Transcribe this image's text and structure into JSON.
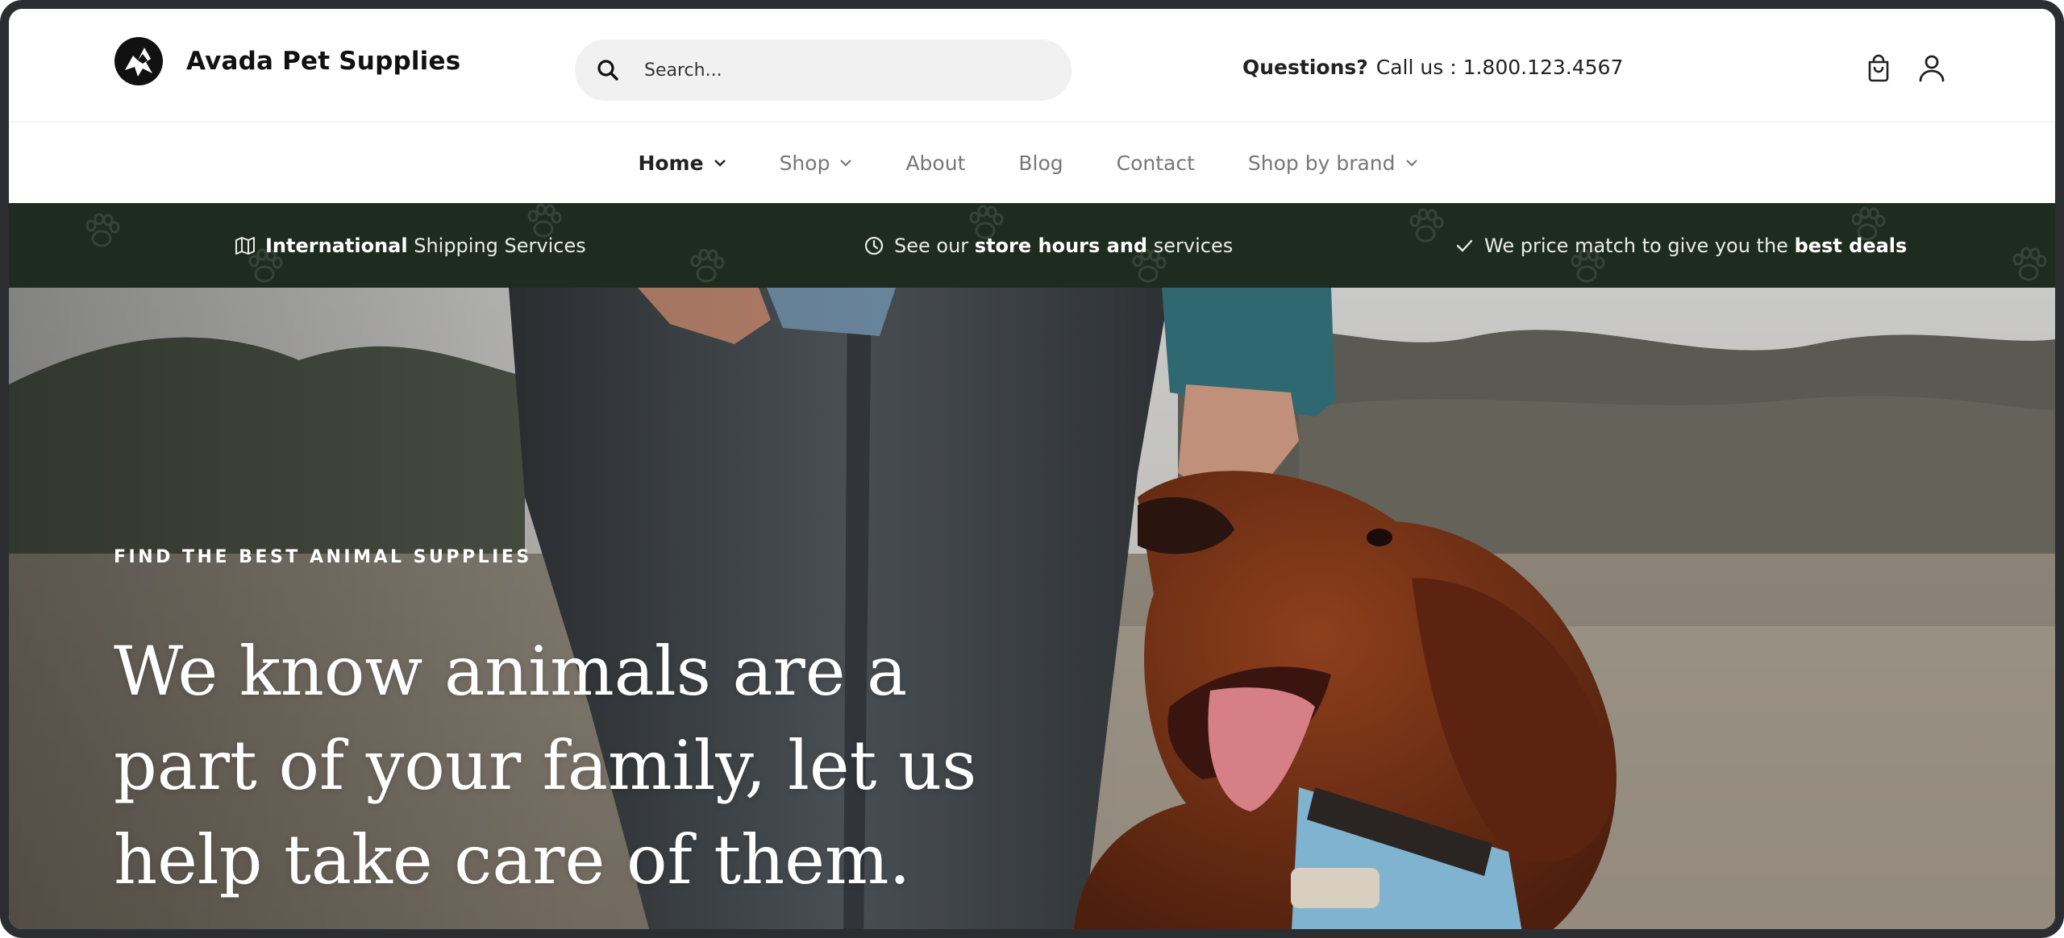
{
  "header": {
    "brand_name": "Avada Pet Supplies",
    "search": {
      "placeholder": "Search..."
    },
    "contact": {
      "question_label": "Questions?",
      "call_text": "Call us : 1.800.123.4567"
    },
    "icons": [
      "cart-icon",
      "user-icon",
      "search-icon"
    ]
  },
  "nav": {
    "items": [
      {
        "label": "Home",
        "has_dropdown": true,
        "active": true
      },
      {
        "label": "Shop",
        "has_dropdown": true,
        "active": false
      },
      {
        "label": "About",
        "has_dropdown": false,
        "active": false
      },
      {
        "label": "Blog",
        "has_dropdown": false,
        "active": false
      },
      {
        "label": "Contact",
        "has_dropdown": false,
        "active": false
      },
      {
        "label": "Shop by brand",
        "has_dropdown": true,
        "active": false
      }
    ]
  },
  "promo": {
    "items": [
      {
        "icon": "map-icon",
        "bold": "International",
        "text": " Shipping Services"
      },
      {
        "icon": "clock-icon",
        "pre": "See our ",
        "bold": "store hours and",
        "text": " services"
      },
      {
        "icon": "check-icon",
        "pre": "We price match to give you the ",
        "bold": "best deals"
      }
    ]
  },
  "hero": {
    "eyebrow": "FIND THE BEST ANIMAL SUPPLIES",
    "headline_lines": [
      "We know animals are a",
      "part of your family, let us",
      "help take care of them."
    ]
  },
  "colors": {
    "promo_bar": "#1e2c1f",
    "search_bg": "#f1f1f1",
    "frame": "#2b2d31",
    "nav_inactive": "#777777",
    "nav_active": "#222222"
  }
}
